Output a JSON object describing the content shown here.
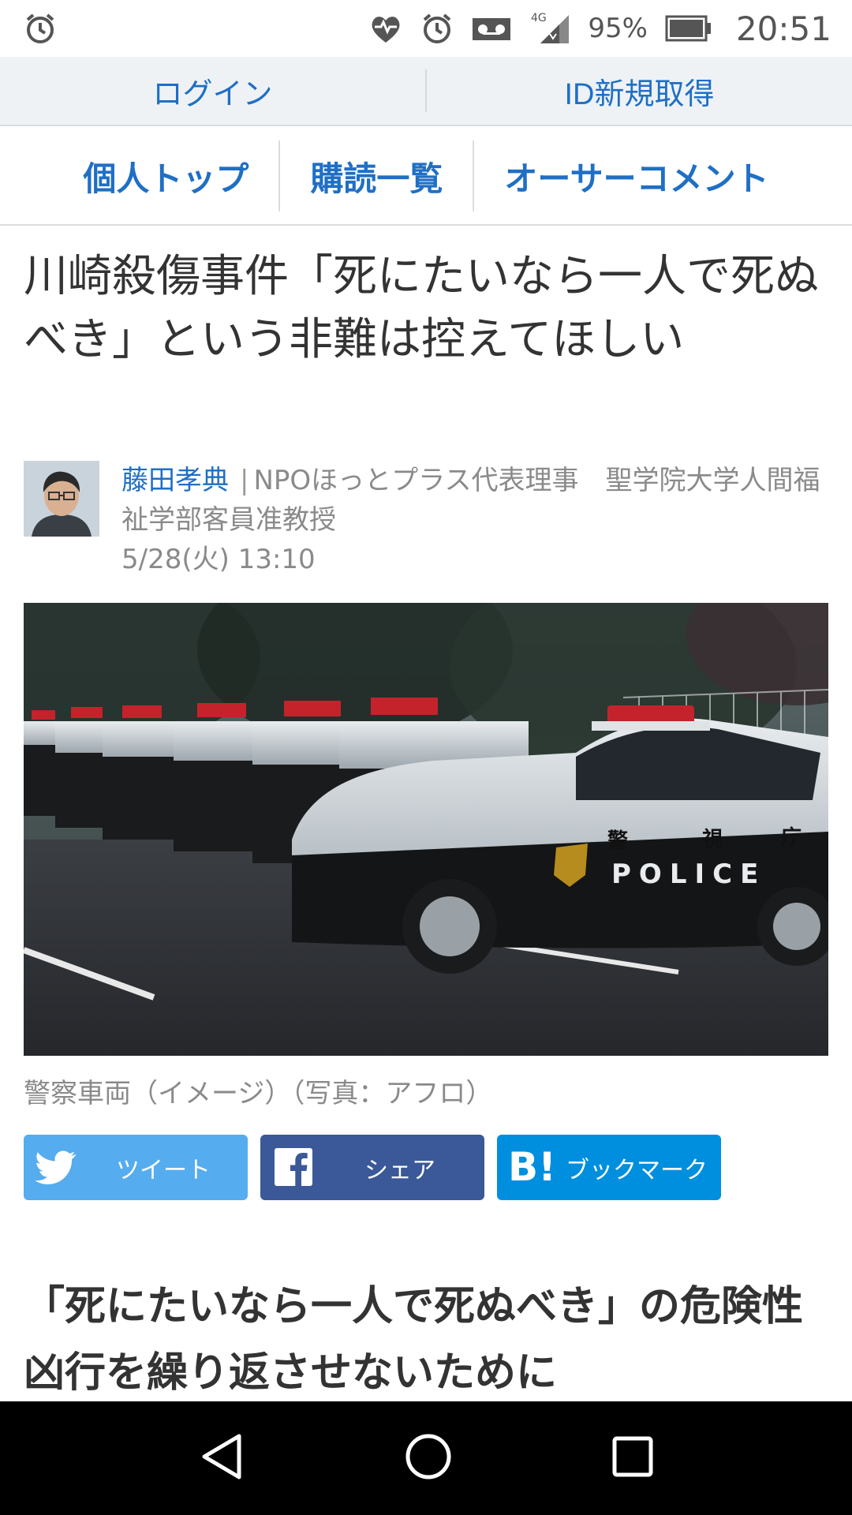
{
  "status_bar": {
    "battery_percent": "95%",
    "time": "20:51",
    "network": "4G",
    "icons": [
      "alarm-icon",
      "heart-monitor-icon",
      "alarm-icon",
      "voicemail-icon",
      "signal-icon",
      "battery-icon"
    ]
  },
  "login_bar": {
    "login_label": "ログイン",
    "register_label": "ID新規取得"
  },
  "nav": {
    "items": [
      {
        "label": "個人トップ"
      },
      {
        "label": "購読一覧"
      },
      {
        "label": "オーサーコメント"
      }
    ]
  },
  "article": {
    "headline": "川崎殺傷事件「死にたいなら一人で死ぬべき」という非難は控えてほしい",
    "author": {
      "name": "藤田孝典",
      "separator": "|",
      "affiliation": "NPOほっとプラス代表理事　聖学院大学人間福祉学部客員准教授",
      "date": "5/28(火) 13:10"
    },
    "image_caption": "警察車両（イメージ）（写真：アフロ）",
    "image_text": {
      "police": "POLICE",
      "kanji": [
        "警",
        "視",
        "庁"
      ]
    },
    "section_title": "「死にたいなら一人で死ぬべき」の危険性　凶行を繰り返させないために"
  },
  "share": {
    "tweet_label": "ツイート",
    "share_label": "シェア",
    "bookmark_label": "ブックマーク",
    "bookmark_icon_text": "B!"
  },
  "colors": {
    "link_blue": "#1f6fc5",
    "twitter": "#55acee",
    "facebook": "#3b5998",
    "hatena": "#008fde"
  }
}
